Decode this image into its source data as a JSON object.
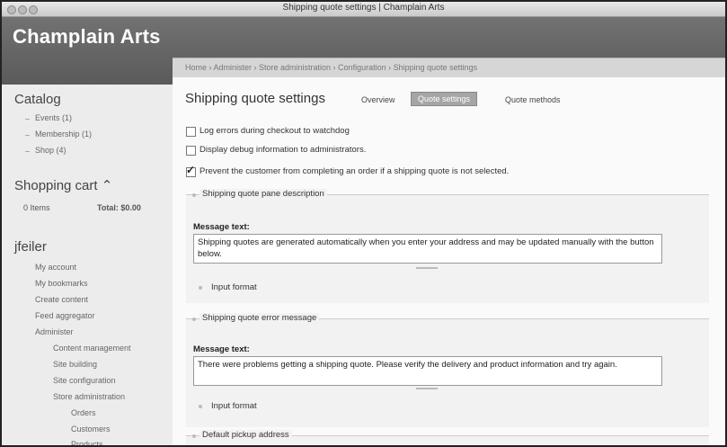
{
  "window": {
    "title": "Shipping quote settings | Champlain Arts"
  },
  "header": {
    "site_name": "Champlain Arts"
  },
  "breadcrumb": {
    "text": "Home › Administer › Store administration › Configuration › Shipping quote settings"
  },
  "sidebar": {
    "catalog": {
      "title": "Catalog",
      "items": [
        {
          "label": "Events (1)"
        },
        {
          "label": "Membership (1)"
        },
        {
          "label": "Shop (4)"
        }
      ]
    },
    "cart": {
      "title": "Shopping cart ⌃",
      "items_label": "0 Items",
      "total_label": "Total: $0.00"
    },
    "user": {
      "title": "jfeiler",
      "items": [
        {
          "label": "My account"
        },
        {
          "label": "My bookmarks"
        },
        {
          "label": "Create content"
        },
        {
          "label": "Feed aggregator"
        },
        {
          "label": "Administer"
        },
        {
          "label": "Content management"
        },
        {
          "label": "Site building"
        },
        {
          "label": "Site configuration"
        },
        {
          "label": "Store administration"
        },
        {
          "label": "Orders"
        },
        {
          "label": "Customers"
        },
        {
          "label": "Products"
        }
      ]
    }
  },
  "main": {
    "title": "Shipping quote settings",
    "tabs": [
      {
        "label": "Overview",
        "active": false
      },
      {
        "label": "Quote settings",
        "active": true
      },
      {
        "label": "Quote methods",
        "active": false
      }
    ],
    "checkboxes": [
      {
        "label": "Log errors during checkout to watchdog",
        "checked": false
      },
      {
        "label": "Display debug information to administrators.",
        "checked": false
      },
      {
        "label": "Prevent the customer from completing an order if a shipping quote is not selected.",
        "checked": true
      }
    ],
    "fieldsets": [
      {
        "legend": "Shipping quote pane description",
        "message_label": "Message text:",
        "message_value": "Shipping quotes are generated automatically when you enter your address and may be updated manually with the button below.",
        "input_format": "Input format"
      },
      {
        "legend": "Shipping quote error message",
        "message_label": "Message text:",
        "message_value": "There were problems getting a shipping quote. Please verify the delivery and product information and try again.",
        "input_format": "Input format"
      },
      {
        "legend": "Default pickup address"
      }
    ]
  }
}
